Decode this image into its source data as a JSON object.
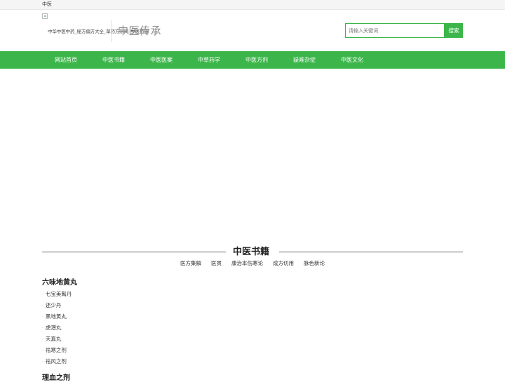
{
  "topbar": {
    "label": "中医"
  },
  "header": {
    "site_desc": "中华中医中药_秘方偏方大全_草药方剂网_中医药网",
    "logo_text": "中医传承",
    "search": {
      "placeholder": "请输入关键词",
      "button": "搜索"
    }
  },
  "nav": {
    "items": [
      "网站首页",
      "中医书籍",
      "中医医案",
      "中草药学",
      "中医方剂",
      "疑难杂症",
      "中医文化"
    ]
  },
  "section": {
    "title": "中医书籍",
    "subcats": [
      "医方集解",
      "医贯",
      "康治本伤寒论",
      "成方切用",
      "脉色新论"
    ]
  },
  "blocks": [
    {
      "title": "六味地黄丸",
      "items": [
        "七宝美髯丹",
        "还少丹",
        "黑地黄丸",
        "虎潜丸",
        "天真丸",
        "祛寒之剂",
        "祛风之剂"
      ]
    },
    {
      "title": "理血之剂",
      "items": []
    }
  ],
  "colors": {
    "accent": "#3cb64a"
  }
}
